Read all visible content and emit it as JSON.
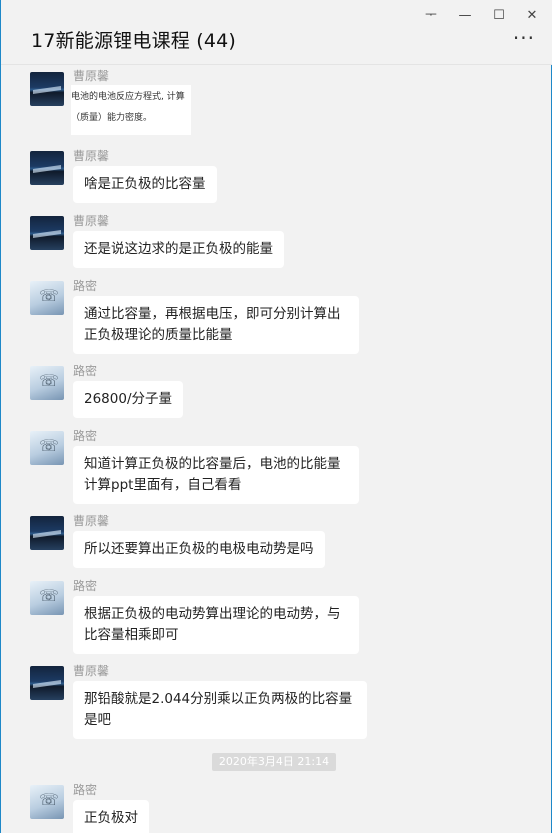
{
  "window": {
    "title": "17新能源锂电课程 (44)",
    "controls": {
      "pin": "ᅮ",
      "minimize": "—",
      "maximize": "☐",
      "close": "✕"
    },
    "more": "···"
  },
  "colors": {
    "accent": "#1e88c8",
    "background": "#f2f2f2",
    "bubble": "#ffffff"
  },
  "messages": [
    {
      "sender": "曹原馨",
      "avatar": "night-lake-avatar",
      "type": "image",
      "image_lines": [
        "电池的电池反应方程式, 计算",
        "（质量）能力密度。"
      ]
    },
    {
      "sender": "曹原馨",
      "avatar": "night-lake-avatar",
      "text": "啥是正负极的比容量"
    },
    {
      "sender": "曹原馨",
      "avatar": "night-lake-avatar",
      "text": "还是说这边求的是正负极的能量"
    },
    {
      "sender": "路密",
      "avatar": "phone-avatar",
      "text": "通过比容量，再根据电压，即可分别计算出正负极理论的质量比能量"
    },
    {
      "sender": "路密",
      "avatar": "phone-avatar",
      "text": "26800/分子量"
    },
    {
      "sender": "路密",
      "avatar": "phone-avatar",
      "text": "知道计算正负极的比容量后，电池的比能量计算ppt里面有，自己看看"
    },
    {
      "sender": "曹原馨",
      "avatar": "night-lake-avatar",
      "text": "所以还要算出正负极的电极电动势是吗"
    },
    {
      "sender": "路密",
      "avatar": "phone-avatar",
      "text": "根据正负极的电动势算出理论的电动势，与比容量相乘即可"
    },
    {
      "sender": "曹原馨",
      "avatar": "night-lake-avatar",
      "text": "那铅酸就是2.044分别乘以正负两极的比容量是吧"
    },
    {
      "sender": "路密",
      "avatar": "phone-avatar",
      "text": "正负极对"
    }
  ],
  "timestamp": "2020年3月4日 21:14"
}
